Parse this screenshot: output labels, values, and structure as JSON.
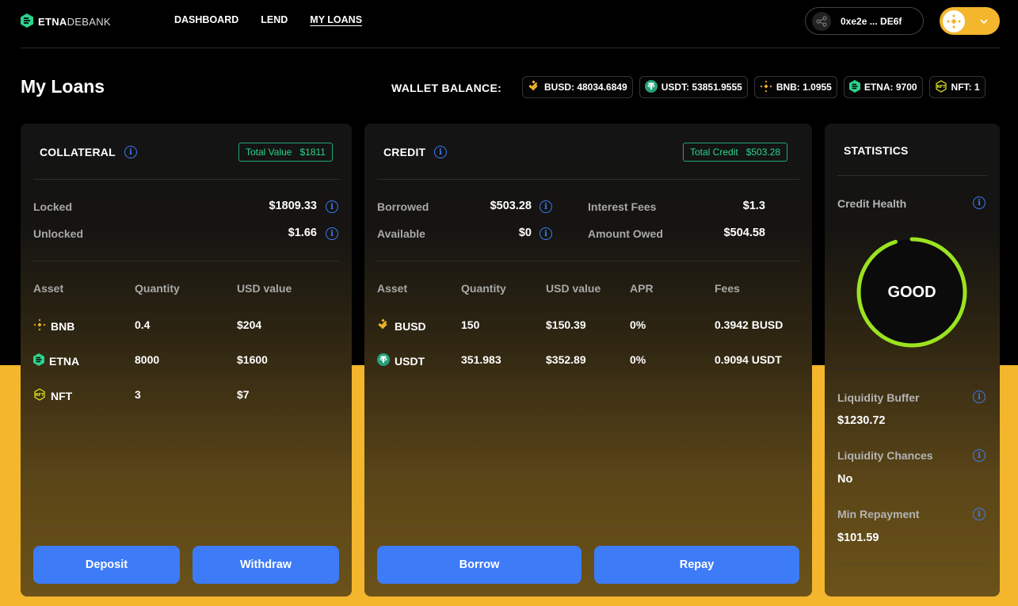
{
  "brand": {
    "part1": "ETNA",
    "part2": "DEBANK"
  },
  "nav": {
    "items": [
      "DASHBOARD",
      "LEND",
      "MY LOANS"
    ],
    "active": "MY LOANS"
  },
  "wallet": {
    "address": "0xe2e ... DE6f"
  },
  "page": {
    "title": "My Loans"
  },
  "balances": {
    "label": "WALLET BALANCE:",
    "items": [
      {
        "icon": "busd-icon",
        "text": "BUSD: 48034.6849"
      },
      {
        "icon": "usdt-icon",
        "text": "USDT: 53851.9555"
      },
      {
        "icon": "bnb-icon",
        "text": "BNB: 1.0955"
      },
      {
        "icon": "etna-icon",
        "text": "ETNA: 9700"
      },
      {
        "icon": "nft-icon",
        "text": "NFT: 1"
      }
    ]
  },
  "collateral": {
    "title": "COLLATERAL",
    "badge_label": "Total Value",
    "badge_value": "$1811",
    "locked_label": "Locked",
    "locked_value": "$1809.33",
    "unlocked_label": "Unlocked",
    "unlocked_value": "$1.66",
    "columns": [
      "Asset",
      "Quantity",
      "USD value"
    ],
    "rows": [
      {
        "icon": "bnb-icon",
        "asset": "BNB",
        "quantity": "0.4",
        "usd": "$204"
      },
      {
        "icon": "etna-icon",
        "asset": "ETNA",
        "quantity": "8000",
        "usd": "$1600"
      },
      {
        "icon": "nft-icon",
        "asset": "NFT",
        "quantity": "3",
        "usd": "$7"
      }
    ],
    "deposit_label": "Deposit",
    "withdraw_label": "Withdraw"
  },
  "credit": {
    "title": "CREDIT",
    "badge_label": "Total Credit",
    "badge_value": "$503.28",
    "borrowed_label": "Borrowed",
    "borrowed_value": "$503.28",
    "available_label": "Available",
    "available_value": "$0",
    "interest_label": "Interest Fees",
    "interest_value": "$1.3",
    "owed_label": "Amount Owed",
    "owed_value": "$504.58",
    "columns": [
      "Asset",
      "Quantity",
      "USD value",
      "APR",
      "Fees"
    ],
    "rows": [
      {
        "icon": "busd-icon",
        "asset": "BUSD",
        "quantity": "150",
        "usd": "$150.39",
        "apr": "0%",
        "fees": "0.3942 BUSD"
      },
      {
        "icon": "usdt-icon",
        "asset": "USDT",
        "quantity": "351.983",
        "usd": "$352.89",
        "apr": "0%",
        "fees": "0.9094 USDT"
      }
    ],
    "borrow_label": "Borrow",
    "repay_label": "Repay"
  },
  "statistics": {
    "title": "STATISTICS",
    "health_label": "Credit Health",
    "health_value": "GOOD",
    "health_fraction": 0.95,
    "buffer_label": "Liquidity Buffer",
    "buffer_value": "$1230.72",
    "chances_label": "Liquidity Chances",
    "chances_value": "No",
    "repay_label": "Min Repayment",
    "repay_value": "$101.59"
  },
  "colors": {
    "accent": "#3d7bf7",
    "brand_yellow": "#f3b62c",
    "health_green": "#9be320",
    "badge_green": "#2bd38c"
  }
}
